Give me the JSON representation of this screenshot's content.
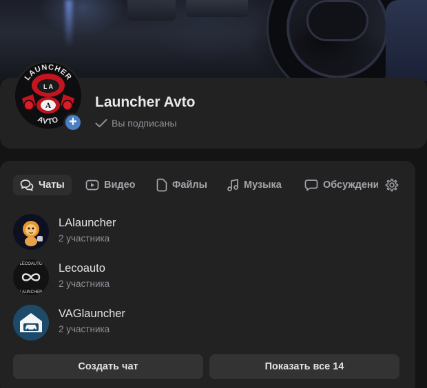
{
  "group": {
    "name": "Launcher Avto",
    "subscribed_label": "Вы подписаны",
    "avatar_text_top": "LAUNCHER",
    "avatar_text_mid": "L A",
    "avatar_text_bottom": "AVTO"
  },
  "tabs": [
    {
      "label": "Чаты",
      "icon": "chat-bubbles-icon",
      "active": true
    },
    {
      "label": "Видео",
      "icon": "video-play-icon",
      "active": false
    },
    {
      "label": "Файлы",
      "icon": "file-icon",
      "active": false
    },
    {
      "label": "Музыка",
      "icon": "music-note-icon",
      "active": false
    },
    {
      "label": "Обсуждения",
      "icon": "discussion-bubble-icon",
      "active": false
    }
  ],
  "chats": [
    {
      "title": "LAlauncher",
      "subtitle": "2 участника",
      "avatar": "lion-avatar"
    },
    {
      "title": "Lecoauto",
      "subtitle": "2 участника",
      "avatar": "infinity-avatar",
      "avatar_text_top": "LECOAUTO",
      "avatar_text_bottom": "LAUNCHER"
    },
    {
      "title": "VAGlauncher",
      "subtitle": "2 участника",
      "avatar": "garage-avatar"
    }
  ],
  "buttons": {
    "create_chat": "Создать чат",
    "show_all": "Показать все 14"
  },
  "colors": {
    "background": "#141414",
    "card": "#222222",
    "accent_blue": "#4a7fc6",
    "text_primary": "#e1e3e6",
    "text_secondary": "#8d9096"
  }
}
